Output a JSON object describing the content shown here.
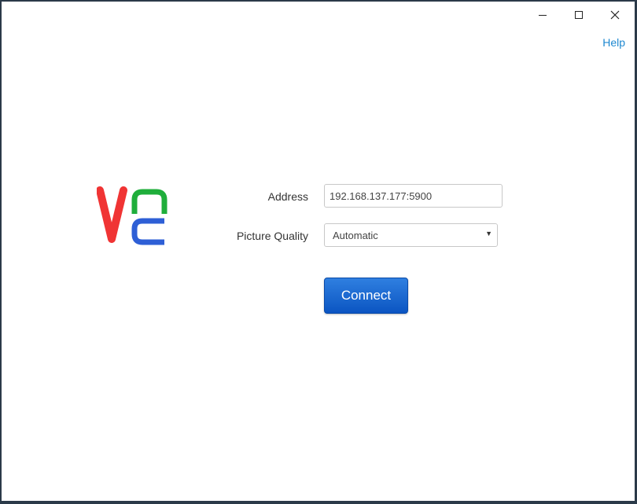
{
  "titlebar": {
    "minimize_icon": "minimize-icon",
    "maximize_icon": "maximize-icon",
    "close_icon": "close-icon"
  },
  "help_label": "Help",
  "logo": {
    "icon": "vnc-logo",
    "colors": {
      "v": "#f03434",
      "n": "#1fae3b",
      "c": "#2e5fd6"
    }
  },
  "form": {
    "address_label": "Address",
    "address_value": "192.168.137.177:5900",
    "quality_label": "Picture Quality",
    "quality_value": "Automatic",
    "connect_label": "Connect"
  },
  "colors": {
    "accent": "#1e88d0",
    "button": "#0b55c2"
  }
}
